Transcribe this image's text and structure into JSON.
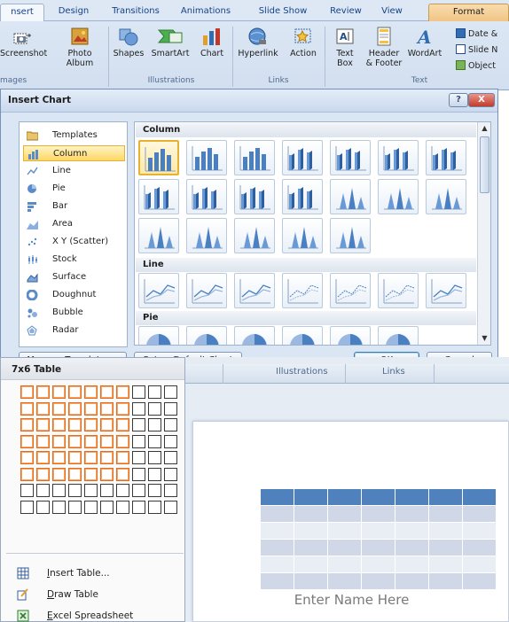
{
  "ribbon": {
    "tabs": [
      {
        "label": "Insert",
        "shown": "nsert"
      },
      {
        "label": "Design"
      },
      {
        "label": "Transitions"
      },
      {
        "label": "Animations"
      },
      {
        "label": "Slide Show"
      },
      {
        "label": "Review"
      },
      {
        "label": "View"
      },
      {
        "label": "Format"
      }
    ],
    "buttons": {
      "screenshot": "Screenshot",
      "photo_album_1": "Photo",
      "photo_album_2": "Album",
      "shapes": "Shapes",
      "smartart": "SmartArt",
      "chart": "Chart",
      "hyperlink": "Hyperlink",
      "action": "Action",
      "textbox_1": "Text",
      "textbox_2": "Box",
      "header_1": "Header",
      "header_2": "& Footer",
      "wordart": "WordArt",
      "date_time": "Date &",
      "slide_number": "Slide N",
      "object": "Object"
    },
    "groups": {
      "images": "mages",
      "illustrations": "Illustrations",
      "links": "Links",
      "text": "Text"
    }
  },
  "dialog": {
    "title": "Insert Chart",
    "help": "?",
    "close": "X",
    "categories": [
      {
        "label": "Templates",
        "icon": "folder-icon"
      },
      {
        "label": "Column",
        "icon": "column-chart-icon",
        "selected": true
      },
      {
        "label": "Line",
        "icon": "line-chart-icon"
      },
      {
        "label": "Pie",
        "icon": "pie-chart-icon"
      },
      {
        "label": "Bar",
        "icon": "bar-chart-icon"
      },
      {
        "label": "Area",
        "icon": "area-chart-icon"
      },
      {
        "label": "X Y (Scatter)",
        "icon": "scatter-chart-icon"
      },
      {
        "label": "Stock",
        "icon": "stock-chart-icon"
      },
      {
        "label": "Surface",
        "icon": "surface-chart-icon"
      },
      {
        "label": "Doughnut",
        "icon": "doughnut-chart-icon"
      },
      {
        "label": "Bubble",
        "icon": "bubble-chart-icon"
      },
      {
        "label": "Radar",
        "icon": "radar-chart-icon"
      }
    ],
    "sections": {
      "column": "Column",
      "line": "Line",
      "pie": "Pie"
    },
    "buttons": {
      "manage_templates": "Manage Templates...",
      "set_default": "Set as Default Chart",
      "ok": "OK",
      "cancel": "Cancel"
    }
  },
  "table_panel": {
    "title": "7x6 Table",
    "grid_cols": 10,
    "grid_rows": 8,
    "selected_cols": 7,
    "selected_rows": 6,
    "menu": [
      {
        "label": "Insert Table...",
        "icon": "insert-table-icon"
      },
      {
        "label": "Draw Table",
        "icon": "draw-table-icon"
      },
      {
        "label": "Excel Spreadsheet",
        "icon": "excel-spreadsheet-icon"
      }
    ]
  },
  "slide": {
    "ribbon_labels": {
      "illustrations": "Illustrations",
      "links": "Links"
    },
    "name_placeholder": "Enter Name Here",
    "table_rows": 6,
    "table_cols": 7,
    "colors": {
      "header": "#4f81bd",
      "band1": "#d0d8e8",
      "band2": "#e9edf4"
    }
  }
}
